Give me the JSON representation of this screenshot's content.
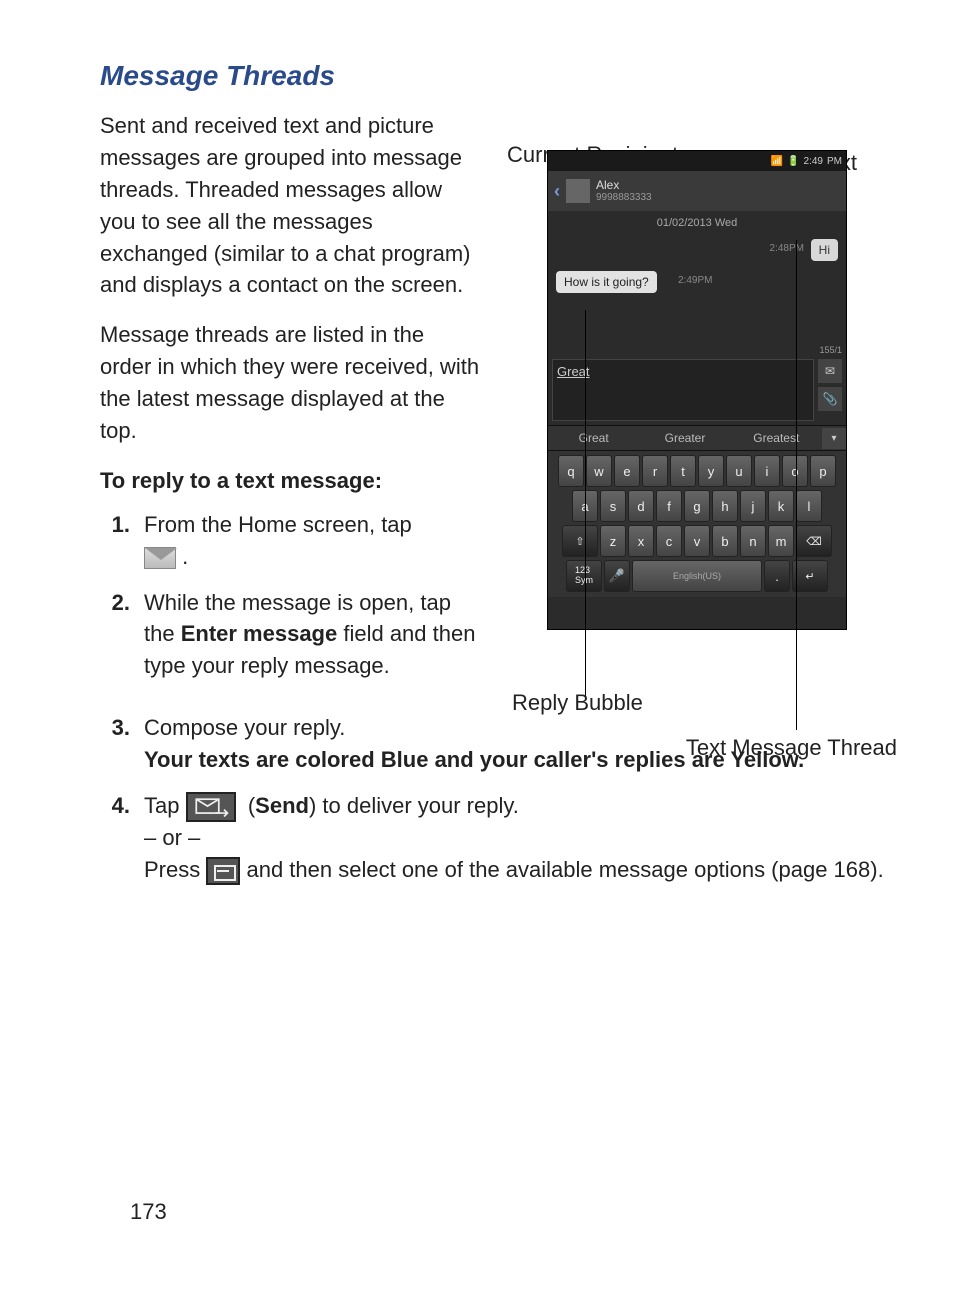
{
  "title": "Message Threads",
  "para1": "Sent and received text and picture messages are grouped into message threads. Threaded messages allow you to see all the messages exchanged (similar to a chat program) and displays a contact on the screen.",
  "para2": "Message threads are listed in the order in which they were received, with the latest message displayed at the top.",
  "instr_heading": "To reply to a text message:",
  "steps": {
    "s1_num": "1.",
    "s1_a": "From the Home screen, tap ",
    "s1_b": ".",
    "s2_num": "2.",
    "s2_a": "While the message is open, tap the ",
    "s2_bold": "Enter message",
    "s2_b": " field and then type your reply message.",
    "s3_num": "3.",
    "s3_a": "Compose your reply.",
    "s3_bold": "Your texts are colored Blue and your caller's replies are Yellow.",
    "s4_num": "4.",
    "s4_a": "Tap ",
    "s4_send_label": "Send",
    "s4_b": ") to deliver your reply.",
    "s4_or": "– or –",
    "s4_c": "Press ",
    "s4_d": " and then select one of the available message options (page 168)."
  },
  "page_number": "173",
  "labels": {
    "current_recipient": "Current Recipient",
    "my_text": "My Text",
    "reply_bubble": "Reply Bubble",
    "thread": "Text Message Thread"
  },
  "phone": {
    "status_time": "2:49",
    "status_ampm": "PM",
    "contact_name": "Alex",
    "contact_number": "9998883333",
    "date": "01/02/2013 Wed",
    "out_bubble": "Hi",
    "out_ts": "2:48PM",
    "in_bubble": "How is it going?",
    "in_ts": "2:49PM",
    "compose_text": "Great",
    "char_count": "155/1",
    "suggest1": "Great",
    "suggest2": "Greater",
    "suggest3": "Greatest",
    "keys_r1": [
      "q",
      "w",
      "e",
      "r",
      "t",
      "y",
      "u",
      "i",
      "o",
      "p"
    ],
    "keys_r2": [
      "a",
      "s",
      "d",
      "f",
      "g",
      "h",
      "j",
      "k",
      "l"
    ],
    "keys_r3_shift": "⇧",
    "keys_r3": [
      "z",
      "x",
      "c",
      "v",
      "b",
      "n",
      "m"
    ],
    "keys_r3_del": "⌫",
    "key_sym": "123\nSym",
    "key_mic": "🎤",
    "key_space": "English(US)",
    "key_dot": ".",
    "key_enter": "↵"
  }
}
